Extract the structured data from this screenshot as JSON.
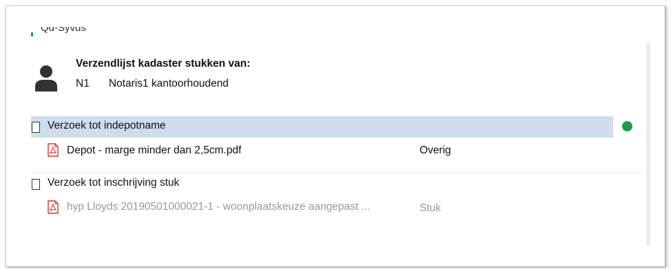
{
  "cut_row": {
    "text": "Qd-Syvds"
  },
  "header": {
    "title": "Verzendlijst kadaster stukken van:",
    "code": "N1",
    "name": "Notaris1 kantoorhoudend"
  },
  "groups": [
    {
      "title": "Verzoek tot indepotname",
      "selected": true,
      "status_color": "#1c9c4e",
      "documents": [
        {
          "name": "Depot - marge minder dan 2,5cm.pdf",
          "type": "Overig",
          "muted": false
        }
      ]
    },
    {
      "title": "Verzoek tot inschrijving stuk",
      "selected": false,
      "documents": [
        {
          "name": "hyp Lloyds 20190501000021-1 - woonplaatskeuze aangepast ...",
          "type": "Stuk",
          "muted": true
        }
      ]
    }
  ],
  "colors": {
    "selection": "#cfdcec",
    "pdf_red": "#d9342b",
    "muted_text": "#999999"
  }
}
